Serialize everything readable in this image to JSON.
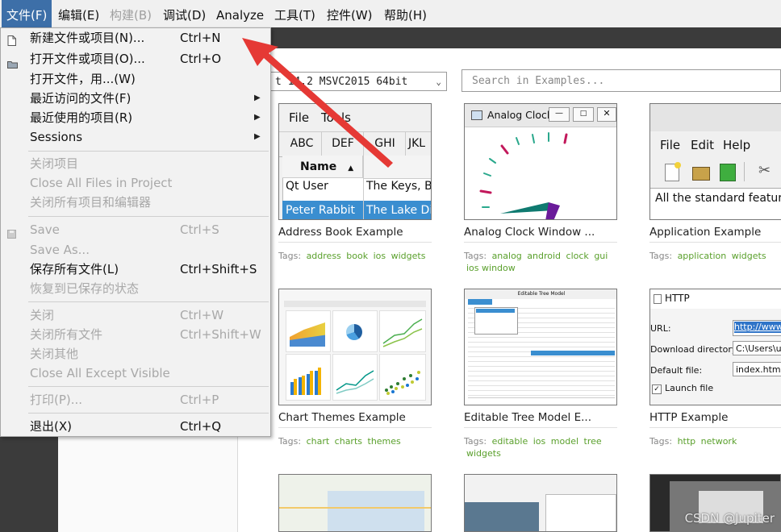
{
  "menubar": {
    "items": [
      {
        "label": "文件(F)",
        "state": "active"
      },
      {
        "label": "编辑(E)",
        "state": "normal"
      },
      {
        "label": "构建(B)",
        "state": "disabled"
      },
      {
        "label": "调试(D)",
        "state": "normal"
      },
      {
        "label": "Analyze",
        "state": "normal"
      },
      {
        "label": "工具(T)",
        "state": "normal"
      },
      {
        "label": "控件(W)",
        "state": "normal"
      },
      {
        "label": "帮助(H)",
        "state": "normal"
      }
    ]
  },
  "kit_combo": {
    "value": "t 14.2 MSVC2015 64bit"
  },
  "search": {
    "placeholder": "Search in Examples..."
  },
  "file_menu": {
    "items": [
      {
        "label": "新建文件或项目(N)...",
        "shortcut": "Ctrl+N",
        "enabled": true,
        "icon": "new-file-icon"
      },
      {
        "label": "打开文件或项目(O)...",
        "shortcut": "Ctrl+O",
        "enabled": true,
        "icon": "open-folder-icon"
      },
      {
        "label": "打开文件，用...(W)",
        "enabled": true
      },
      {
        "label": "最近访问的文件(F)",
        "enabled": true,
        "submenu": true
      },
      {
        "label": "最近使用的项目(R)",
        "enabled": true,
        "submenu": true
      },
      {
        "label": "Sessions",
        "enabled": true,
        "submenu": true
      },
      {
        "label": "关闭项目",
        "enabled": false
      },
      {
        "label": "Close All Files in Project",
        "enabled": false
      },
      {
        "label": "关闭所有项目和编辑器",
        "enabled": false
      },
      {
        "label": "Save",
        "shortcut": "Ctrl+S",
        "enabled": false,
        "icon": "save-icon"
      },
      {
        "label": "Save As...",
        "enabled": false
      },
      {
        "label": "保存所有文件(L)",
        "shortcut": "Ctrl+Shift+S",
        "enabled": true
      },
      {
        "label": "恢复到已保存的状态",
        "enabled": false
      },
      {
        "label": "关闭",
        "shortcut": "Ctrl+W",
        "enabled": false
      },
      {
        "label": "关闭所有文件",
        "shortcut": "Ctrl+Shift+W",
        "enabled": false
      },
      {
        "label": "关闭其他",
        "enabled": false
      },
      {
        "label": "Close All Except Visible",
        "enabled": false
      },
      {
        "label": "打印(P)...",
        "shortcut": "Ctrl+P",
        "enabled": false
      },
      {
        "label": "退出(X)",
        "shortcut": "Ctrl+Q",
        "enabled": true
      }
    ]
  },
  "examples": [
    {
      "title": "Address Book Example",
      "tags_label": "Tags:",
      "tags": [
        "address",
        "book",
        "ios",
        "widgets"
      ],
      "thumb": {
        "menu": [
          "File",
          "Tools"
        ],
        "tabs": [
          "ABC",
          "DEF",
          "GHI",
          "JKL"
        ],
        "col1": "Name",
        "col2": "",
        "rows": [
          [
            "Qt User",
            "The Keys,  B"
          ],
          [
            "Peter Rabbit",
            "The Lake Dis"
          ]
        ]
      }
    },
    {
      "title": "Analog Clock Window ...",
      "tags_label": "Tags:",
      "tags": [
        "analog",
        "android",
        "clock",
        "gui",
        "ios",
        "window"
      ],
      "thumb": {
        "window_title": "Analog Clock"
      }
    },
    {
      "title": "Application Example",
      "tags_label": "Tags:",
      "tags": [
        "application",
        "widgets"
      ],
      "thumb": {
        "menu": [
          "File",
          "Edit",
          "Help"
        ],
        "text": "All the standard features"
      }
    },
    {
      "title": "Chart Themes Example",
      "tags_label": "Tags:",
      "tags": [
        "chart",
        "charts",
        "themes"
      ],
      "thumb": {}
    },
    {
      "title": "Editable Tree Model E...",
      "tags_label": "Tags:",
      "tags": [
        "editable",
        "ios",
        "model",
        "tree",
        "widgets"
      ],
      "thumb": {
        "window_title": "Editable Tree Model"
      }
    },
    {
      "title": "HTTP Example",
      "tags_label": "Tags:",
      "tags": [
        "http",
        "network"
      ],
      "thumb": {
        "window_title": "HTTP",
        "url_label": "URL:",
        "url_value": "http://www",
        "dir_label": "Download directory:",
        "dir_value": "C:\\Users\\us",
        "file_label": "Default file:",
        "file_value": "index.html",
        "launch_label": "Launch file"
      }
    }
  ],
  "watermark": "CSDN @Jupiter"
}
